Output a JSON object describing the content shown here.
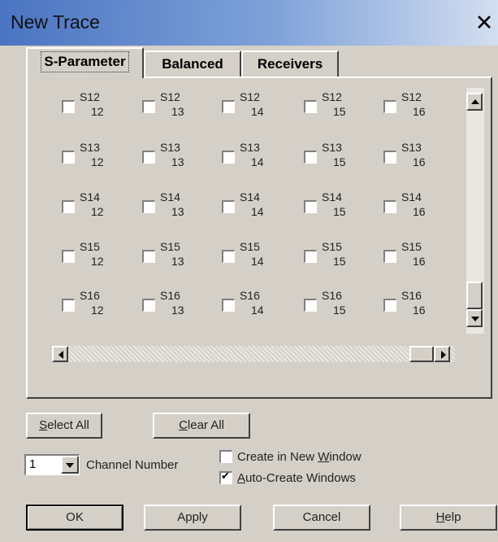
{
  "window": {
    "title": "New Trace"
  },
  "tabs": [
    {
      "label": "S-Parameter",
      "active": true
    },
    {
      "label": "Balanced",
      "active": false
    },
    {
      "label": "Receivers",
      "active": false
    }
  ],
  "grid": {
    "rows": [
      {
        "label": "S12",
        "subs": [
          "12",
          "13",
          "14",
          "15",
          "16"
        ]
      },
      {
        "label": "S13",
        "subs": [
          "12",
          "13",
          "14",
          "15",
          "16"
        ]
      },
      {
        "label": "S14",
        "subs": [
          "12",
          "13",
          "14",
          "15",
          "16"
        ]
      },
      {
        "label": "S15",
        "subs": [
          "12",
          "13",
          "14",
          "15",
          "16"
        ]
      },
      {
        "label": "S16",
        "subs": [
          "12",
          "13",
          "14",
          "15",
          "16"
        ]
      }
    ]
  },
  "buttons": {
    "select_all": {
      "pre": "",
      "key": "S",
      "post": "elect All"
    },
    "clear_all": {
      "pre": "",
      "key": "C",
      "post": "lear All"
    },
    "ok": "OK",
    "apply": "Apply",
    "cancel": "Cancel",
    "help": {
      "pre": "",
      "key": "H",
      "post": "elp"
    }
  },
  "channel": {
    "value": "1",
    "label": "Channel Number"
  },
  "options": {
    "create_new_window": {
      "pre": "Create in New ",
      "key": "W",
      "post": "indow",
      "checked": false
    },
    "auto_create": {
      "pre": "",
      "key": "A",
      "post": "uto-Create Windows",
      "checked": true
    }
  }
}
